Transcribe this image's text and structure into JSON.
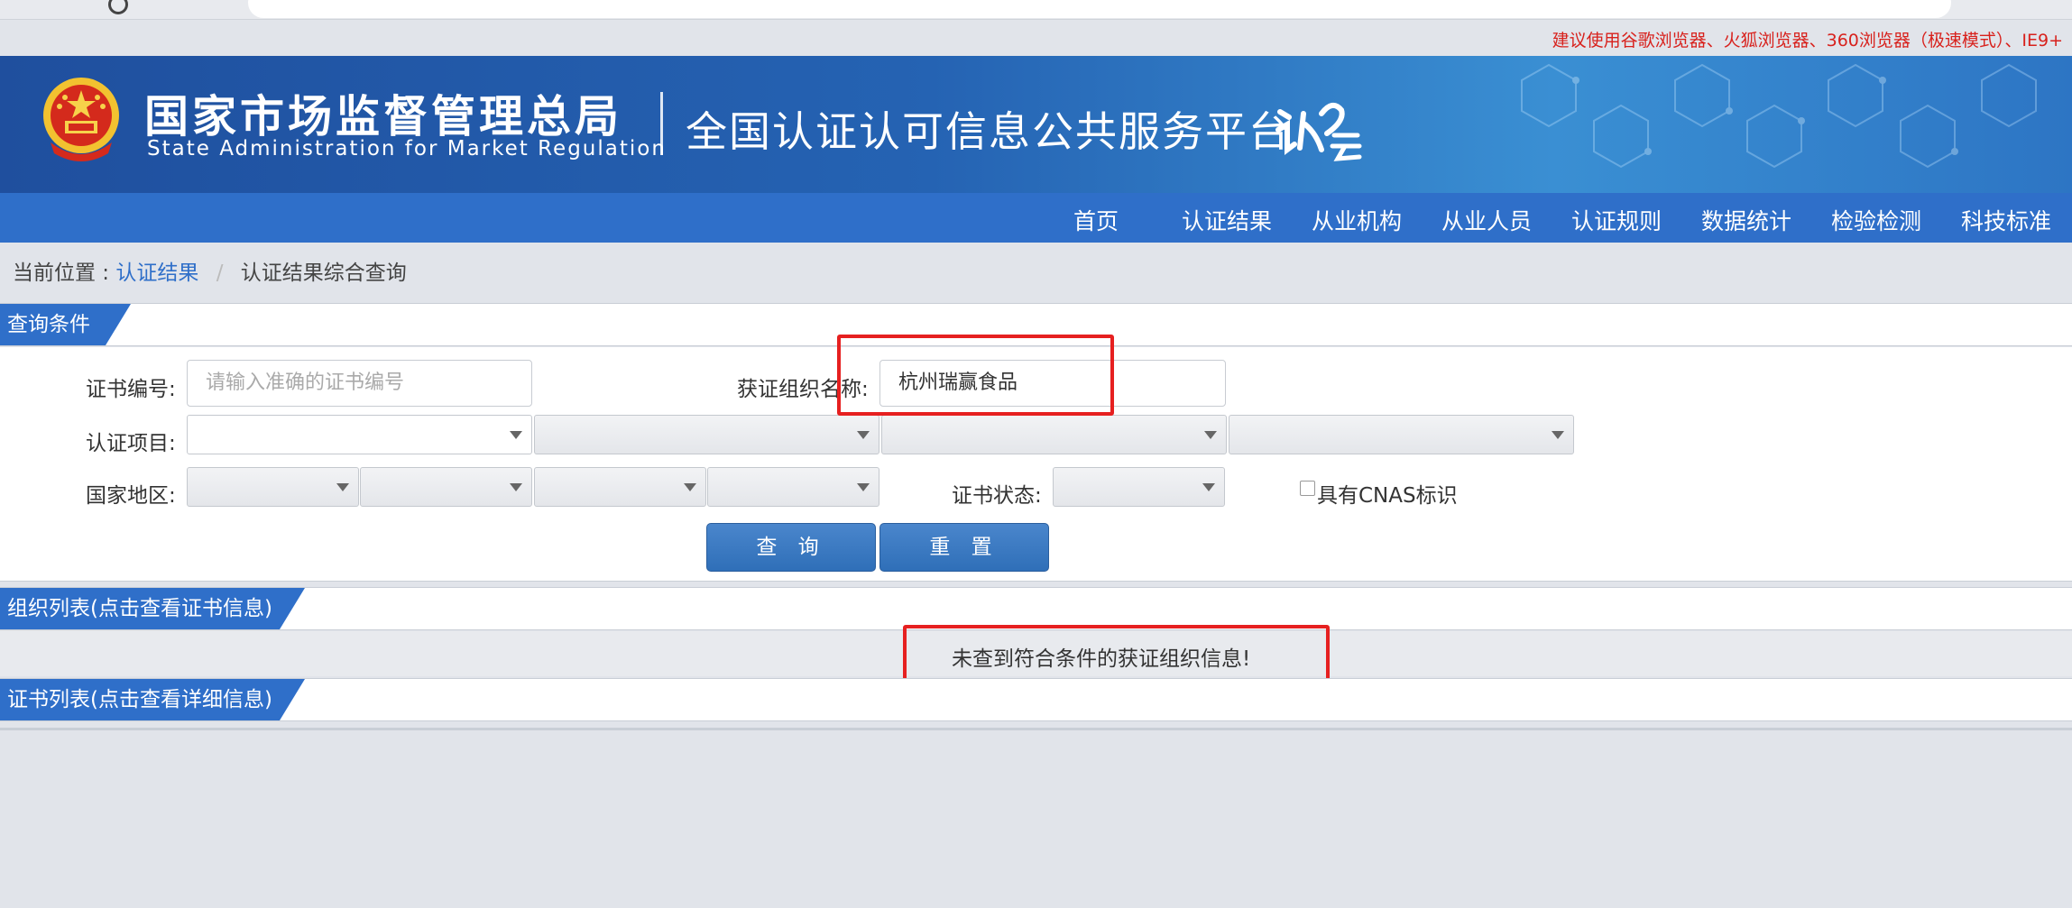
{
  "browser": {
    "tip": "建议使用谷歌浏览器、火狐浏览器、360浏览器（极速模式）、IE9+"
  },
  "header": {
    "org_cn": "国家市场监督管理总局",
    "org_en": "State Administration for Market Regulation",
    "platform": "全国认证认可信息公共服务平台",
    "logo_text": "认云"
  },
  "nav": {
    "items": [
      "首页",
      "认证结果",
      "从业机构",
      "从业人员",
      "认证规则",
      "数据统计",
      "检验检测",
      "科技标准"
    ]
  },
  "breadcrumb": {
    "prefix": "当前位置 :",
    "link": "认证结果",
    "separator": "/",
    "current": "认证结果综合查询"
  },
  "query": {
    "section_title": "查询条件",
    "cert_no_label": "证书编号:",
    "cert_no_placeholder": "请输入准确的证书编号",
    "org_name_label": "获证组织名称:",
    "org_name_value": "杭州瑞赢食品",
    "project_label": "认证项目:",
    "region_label": "国家地区:",
    "status_label": "证书状态:",
    "cnas_label": "具有CNAS标识",
    "search_button": "查 询",
    "reset_button": "重 置"
  },
  "org_list": {
    "section_title": "组织列表(点击查看证书信息)",
    "empty_message": "未查到符合条件的获证组织信息!"
  },
  "cert_list": {
    "section_title": "证书列表(点击查看详细信息)"
  },
  "colors": {
    "brand_blue": "#2f6fc9",
    "highlight_red": "#e62020",
    "tip_red": "#d8211c"
  }
}
